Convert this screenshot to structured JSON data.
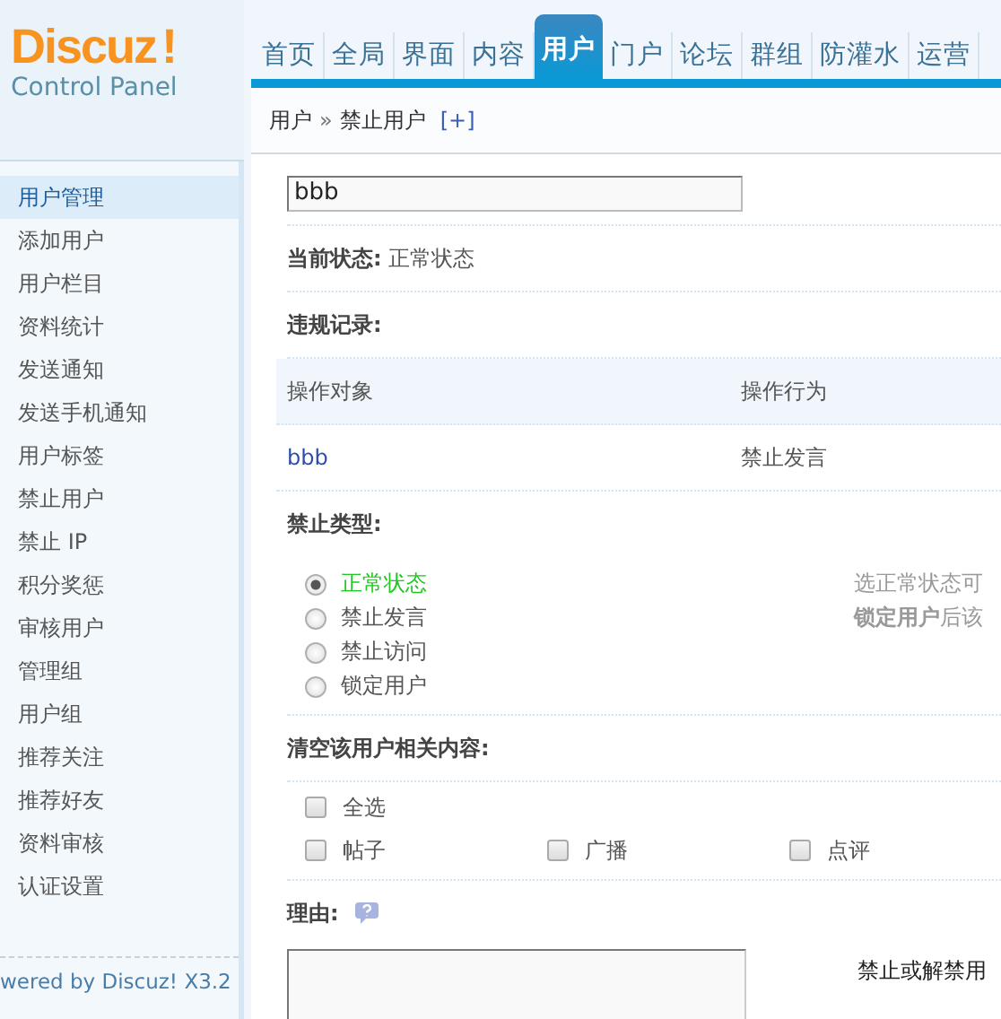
{
  "logo": {
    "brand": "Discuz",
    "mark": "!",
    "subtitle": "Control Panel"
  },
  "nav": [
    {
      "label": "首页",
      "selected": false
    },
    {
      "label": "全局",
      "selected": false
    },
    {
      "label": "界面",
      "selected": false
    },
    {
      "label": "内容",
      "selected": false
    },
    {
      "label": "用户",
      "selected": true
    },
    {
      "label": "门户",
      "selected": false
    },
    {
      "label": "论坛",
      "selected": false
    },
    {
      "label": "群组",
      "selected": false
    },
    {
      "label": "防灌水",
      "selected": false
    },
    {
      "label": "运营",
      "selected": false
    }
  ],
  "breadcrumb": {
    "parent": "用户",
    "separator": "»",
    "current": "禁止用户",
    "add": "[+]"
  },
  "sidebar": {
    "items": [
      {
        "label": "用户管理",
        "selected": true
      },
      {
        "label": "添加用户",
        "selected": false
      },
      {
        "label": "用户栏目",
        "selected": false
      },
      {
        "label": "资料统计",
        "selected": false
      },
      {
        "label": "发送通知",
        "selected": false
      },
      {
        "label": "发送手机通知",
        "selected": false
      },
      {
        "label": "用户标签",
        "selected": false
      },
      {
        "label": "禁止用户",
        "selected": false
      },
      {
        "label": "禁止 IP",
        "selected": false
      },
      {
        "label": "积分奖惩",
        "selected": false
      },
      {
        "label": "审核用户",
        "selected": false
      },
      {
        "label": "管理组",
        "selected": false
      },
      {
        "label": "用户组",
        "selected": false
      },
      {
        "label": "推荐关注",
        "selected": false
      },
      {
        "label": "推荐好友",
        "selected": false
      },
      {
        "label": "资料审核",
        "selected": false
      },
      {
        "label": "认证设置",
        "selected": false
      }
    ],
    "footer": "wered by Discuz! X3.2"
  },
  "form": {
    "username": "bbb",
    "status_label": "当前状态:",
    "status_value": "正常状态",
    "records_label": "违规记录:",
    "records": {
      "columns": [
        "操作对象",
        "操作行为"
      ],
      "rows": [
        [
          "bbb",
          "禁止发言"
        ]
      ]
    },
    "ban_type_label": "禁止类型:",
    "ban_types": [
      {
        "label": "正常状态",
        "selected": true
      },
      {
        "label": "禁止发言",
        "selected": false
      },
      {
        "label": "禁止访问",
        "selected": false
      },
      {
        "label": "锁定用户",
        "selected": false
      }
    ],
    "ban_hint": [
      "选正常状态可",
      "**锁定用户**后该"
    ],
    "clear_label": "清空该用户相关内容:",
    "select_all": {
      "label": "全选",
      "checked": false
    },
    "clear_items": [
      {
        "label": "帖子",
        "checked": false
      },
      {
        "label": "广播",
        "checked": false
      },
      {
        "label": "点评",
        "checked": false
      }
    ],
    "reason_label": "理由:",
    "reason_hint": "禁止或解禁用"
  }
}
